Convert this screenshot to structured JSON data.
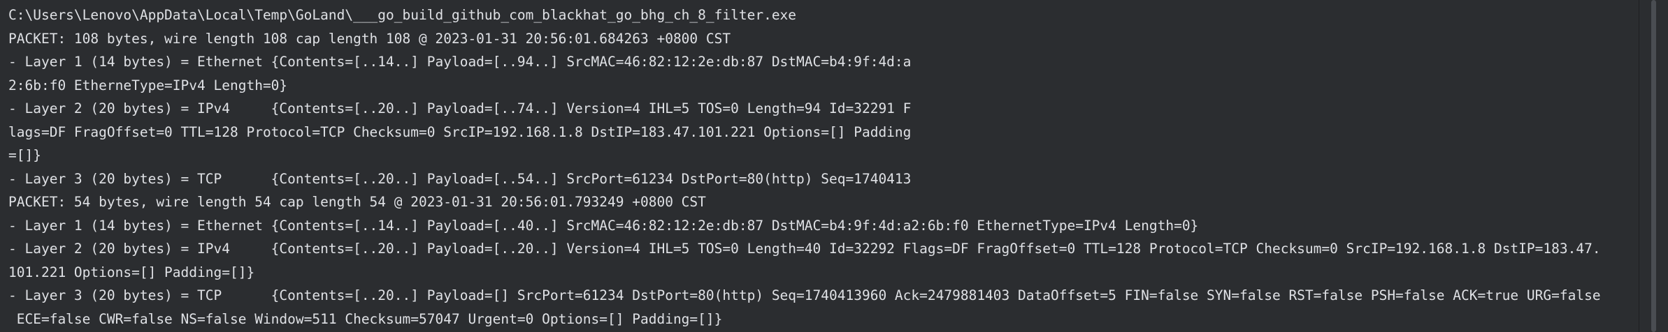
{
  "console": {
    "lines": [
      "C:\\Users\\Lenovo\\AppData\\Local\\Temp\\GoLand\\___go_build_github_com_blackhat_go_bhg_ch_8_filter.exe",
      "PACKET: 108 bytes, wire length 108 cap length 108 @ 2023-01-31 20:56:01.684263 +0800 CST",
      "- Layer 1 (14 bytes) = Ethernet {Contents=[..14..] Payload=[..94..] SrcMAC=46:82:12:2e:db:87 DstMAC=b4:9f:4d:a",
      "2:6b:f0 EtherneType=IPv4 Length=0}",
      "- Layer 2 (20 bytes) = IPv4     {Contents=[..20..] Payload=[..74..] Version=4 IHL=5 TOS=0 Length=94 Id=32291 F",
      "lags=DF FragOffset=0 TTL=128 Protocol=TCP Checksum=0 SrcIP=192.168.1.8 DstIP=183.47.101.221 Options=[] Padding",
      "=[]}",
      "- Layer 3 (20 bytes) = TCP      {Contents=[..20..] Payload=[..54..] SrcPort=61234 DstPort=80(http) Seq=1740413",
      "PACKET: 54 bytes, wire length 54 cap length 54 @ 2023-01-31 20:56:01.793249 +0800 CST",
      "- Layer 1 (14 bytes) = Ethernet {Contents=[..14..] Payload=[..40..] SrcMAC=46:82:12:2e:db:87 DstMAC=b4:9f:4d:a2:6b:f0 EthernetType=IPv4 Length=0}",
      "- Layer 2 (20 bytes) = IPv4     {Contents=[..20..] Payload=[..20..] Version=4 IHL=5 TOS=0 Length=40 Id=32292 Flags=DF FragOffset=0 TTL=128 Protocol=TCP Checksum=0 SrcIP=192.168.1.8 DstIP=183.47.",
      "101.221 Options=[] Padding=[]}",
      "- Layer 3 (20 bytes) = TCP      {Contents=[..20..] Payload=[] SrcPort=61234 DstPort=80(http) Seq=1740413960 Ack=2479881403 DataOffset=5 FIN=false SYN=false RST=false PSH=false ACK=true URG=false",
      " ECE=false CWR=false NS=false Window=511 Checksum=57047 Urgent=0 Options=[] Padding=[]}"
    ]
  },
  "colors": {
    "background": "#2b2d30",
    "text": "#dfe1e5",
    "scrollbar_thumb": "#4a4d52"
  }
}
